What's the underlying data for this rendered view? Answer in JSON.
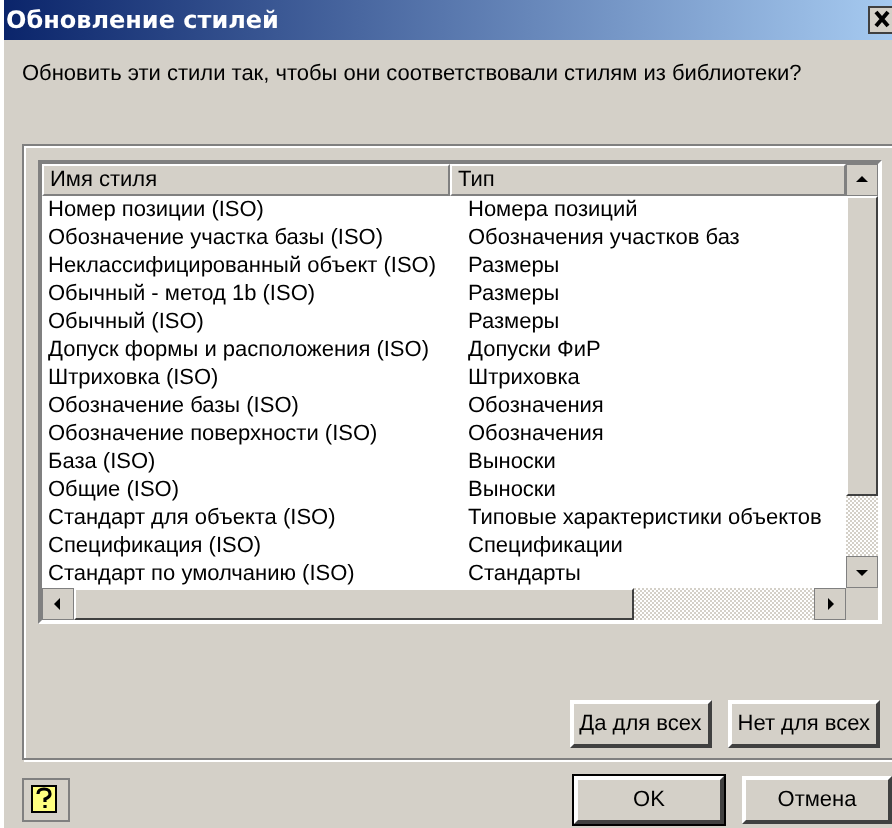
{
  "window": {
    "title": "Обновление стилей"
  },
  "question": "Обновить эти стили так, чтобы они соответствовали стилям из библиотеки?",
  "table": {
    "columns": [
      "Имя стиля",
      "Тип"
    ],
    "rows": [
      {
        "name": "Номер позиции (ISO)",
        "type": "Номера позиций"
      },
      {
        "name": "Обозначение участка базы (ISO)",
        "type": "Обозначения участков баз"
      },
      {
        "name": "Неклассифицированный объект (ISO)",
        "type": "Размеры"
      },
      {
        "name": "Обычный - метод 1b (ISO)",
        "type": "Размеры"
      },
      {
        "name": "Обычный (ISO)",
        "type": "Размеры"
      },
      {
        "name": "Допуск формы и расположения (ISO)",
        "type": "Допуски ФиР"
      },
      {
        "name": "Штриховка (ISO)",
        "type": "Штриховка"
      },
      {
        "name": "Обозначение базы (ISO)",
        "type": "Обозначения"
      },
      {
        "name": "Обозначение поверхности (ISO)",
        "type": "Обозначения"
      },
      {
        "name": "База (ISO)",
        "type": "Выноски"
      },
      {
        "name": "Общие (ISO)",
        "type": "Выноски"
      },
      {
        "name": "Стандарт для объекта (ISO)",
        "type": "Типовые характеристики объектов"
      },
      {
        "name": "Спецификация (ISO)",
        "type": "Спецификации"
      },
      {
        "name": "Стандарт по умолчанию (ISO)",
        "type": "Стандарты"
      }
    ]
  },
  "group_buttons": [
    "Да для всех",
    "Нет для всех"
  ],
  "buttons": [
    {
      "label": "OK",
      "default": true
    },
    {
      "label": "Отмена",
      "default": false
    }
  ]
}
